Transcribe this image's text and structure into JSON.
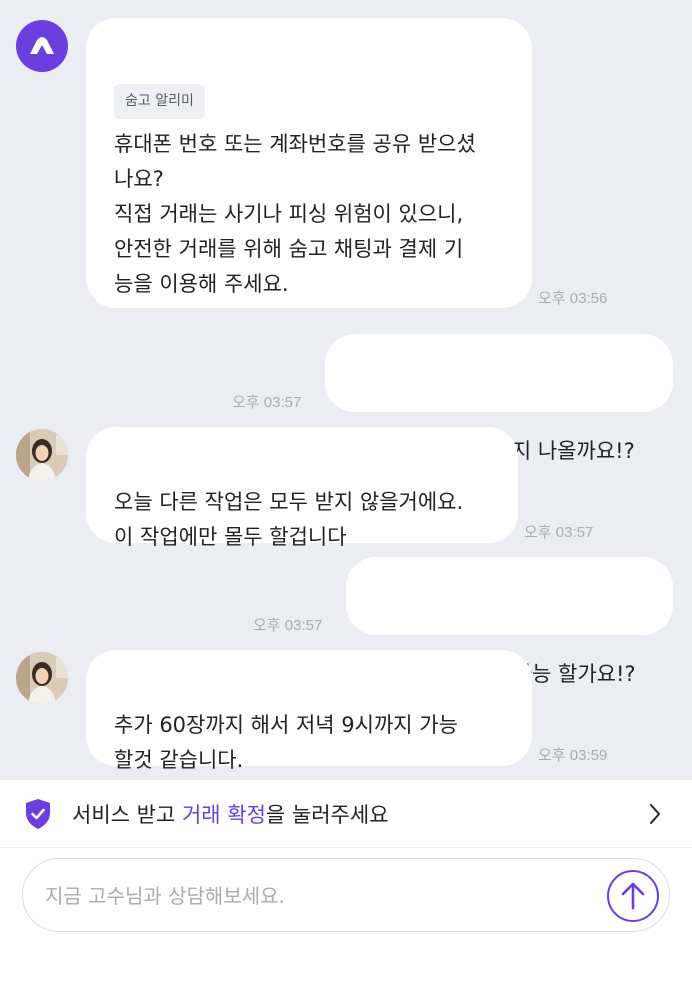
{
  "messages": [
    {
      "sender": "system",
      "tag": "숨고 알리미",
      "text": "휴대폰 번호 또는 계좌번호를 공유 받으셨\n나요?\n직접 거래는 사기나 피싱 위험이 있으니,\n안전한 거래를 위해 숨고 채팅과 결제 기\n능을 이용해 주세요.",
      "time": "오후 03:56"
    },
    {
      "sender": "me",
      "text": "그럼 오늘 몇시까지 나올까요!?",
      "time": "오후 03:57"
    },
    {
      "sender": "expert",
      "text": "오늘 다른 작업은 모두 받지 않을거에요.\n이 작업에만 몰두 할겁니다",
      "time": "오후 03:57"
    },
    {
      "sender": "me",
      "text": "그럼 몇시까지 가능 할가요!?",
      "time": "오후 03:57"
    },
    {
      "sender": "expert",
      "text": "추가 60장까지 해서 저녁 9시까지 가능\n할것 같습니다.",
      "time": "오후 03:59"
    }
  ],
  "confirm_banner": {
    "prefix": "서비스 받고 ",
    "highlight": "거래 확정",
    "suffix": "을 눌러주세요",
    "icon": "shield-check-icon",
    "chevron": "chevron-right-icon"
  },
  "composer": {
    "placeholder": "지금 고수님과 상담해보세요.",
    "send_icon": "arrow-up-icon"
  },
  "colors": {
    "accent": "#6a3fe0",
    "chat_background": "#ecedf2",
    "bubble": "#ffffff",
    "timestamp": "#a7abb3"
  }
}
